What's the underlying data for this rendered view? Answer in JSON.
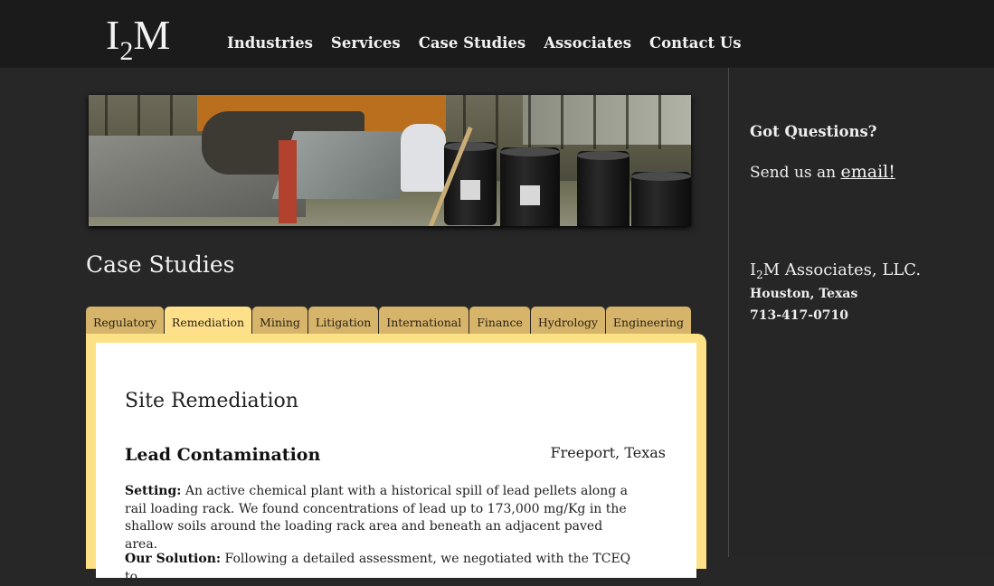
{
  "header": {
    "logo_main": "I",
    "logo_sub": "2",
    "logo_end": "M",
    "nav": [
      "Industries",
      "Services",
      "Case Studies",
      "Associates",
      "Contact Us"
    ]
  },
  "main": {
    "page_title": "Case Studies",
    "tabs": [
      "Regulatory",
      "Remediation",
      "Mining",
      "Litigation",
      "International",
      "Finance",
      "Hydrology",
      "Engineering"
    ],
    "active_tab": "Remediation",
    "section_title": "Site Remediation",
    "case": {
      "title": "Lead Contamination",
      "location": "Freeport, Texas",
      "setting_label": "Setting:",
      "setting_text": " An active chemical plant with a historical spill of lead pellets along a rail loading rack. We found concentrations of lead up to 173,000 mg/Kg in the shallow soils around the loading rack area and beneath an adjacent paved area.",
      "solution_label": "Our Solution:",
      "solution_text": " Following a detailed assessment, we negotiated with the TCEQ to"
    }
  },
  "sidebar": {
    "questions": "Got Questions?",
    "email_prefix": "Send us an ",
    "email_link": "email!",
    "company_pre": "I",
    "company_sub": "2",
    "company_post": "M Associates, LLC.",
    "city": "Houston, Texas",
    "phone": "713-417-0710"
  },
  "colors": {
    "background": "#272727",
    "topbar": "#1b1b1b",
    "tab": "#d6b46a",
    "tab_active": "#fde089",
    "panel_border": "#fce187"
  }
}
